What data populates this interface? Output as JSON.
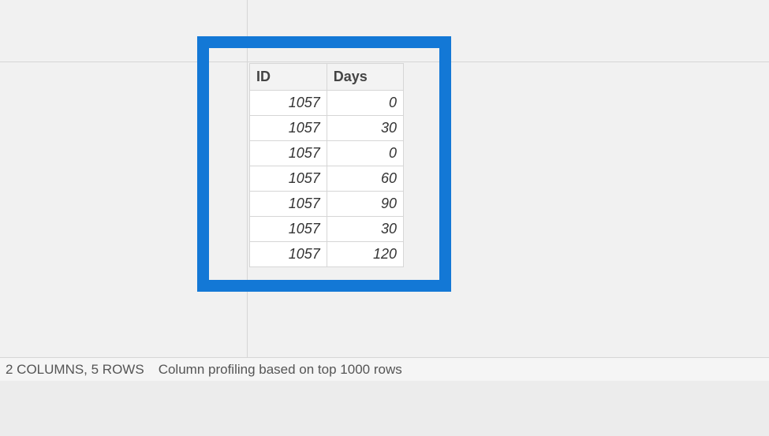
{
  "table": {
    "columns": [
      "ID",
      "Days"
    ],
    "rows": [
      {
        "id": "1057",
        "days": "0"
      },
      {
        "id": "1057",
        "days": "30"
      },
      {
        "id": "1057",
        "days": "0"
      },
      {
        "id": "1057",
        "days": "60"
      },
      {
        "id": "1057",
        "days": "90"
      },
      {
        "id": "1057",
        "days": "30"
      },
      {
        "id": "1057",
        "days": "120"
      }
    ]
  },
  "statusbar": {
    "summary": "2 COLUMNS, 5 ROWS",
    "profiling": "Column profiling based on top 1000 rows"
  },
  "chart_data": {
    "type": "table",
    "columns": [
      "ID",
      "Days"
    ],
    "rows": [
      [
        1057,
        0
      ],
      [
        1057,
        30
      ],
      [
        1057,
        0
      ],
      [
        1057,
        60
      ],
      [
        1057,
        90
      ],
      [
        1057,
        30
      ],
      [
        1057,
        120
      ]
    ]
  }
}
